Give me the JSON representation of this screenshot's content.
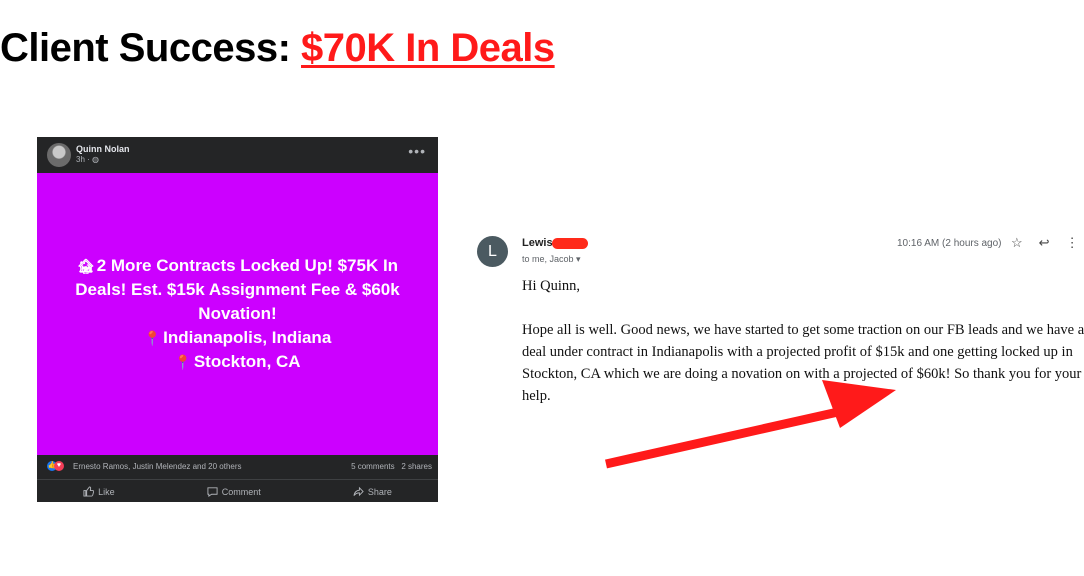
{
  "headline": {
    "prefix": "Client Success: ",
    "highlight": "$70K In Deals",
    "highlight_color": "#ff1a1a"
  },
  "facebook_post": {
    "author": "Quinn Nolan",
    "time": "3h ·",
    "body_color": "#cc00ff",
    "lines": [
      "2 More Contracts Locked Up! $75K In",
      "Deals! Est. $15k Assignment Fee & $60k",
      "Novation!",
      "Indianapolis, Indiana",
      "Stockton, CA"
    ],
    "reactions_names": "Ernesto Ramos, Justin Melendez and 20 others",
    "comments": "5 comments",
    "shares": "2 shares",
    "actions": {
      "like": "Like",
      "comment": "Comment",
      "share": "Share"
    }
  },
  "email": {
    "avatar_letter": "L",
    "sender": "Lewis",
    "recipients": "to me, Jacob",
    "time": "10:16 AM (2 hours ago)",
    "greeting": "Hi Quinn,",
    "body_lines": [
      "Hope all is well.  Good news, we have started to get some traction on our FB leads and we have a",
      "deal under contract in Indianapolis with a projected profit of $15k and one getting locked up in",
      "Stockton, CA which we are doing a novation on with a projected of $60k!  So thank you for your",
      "help."
    ]
  },
  "annotation": {
    "arrow_color": "#ff1a1a"
  }
}
